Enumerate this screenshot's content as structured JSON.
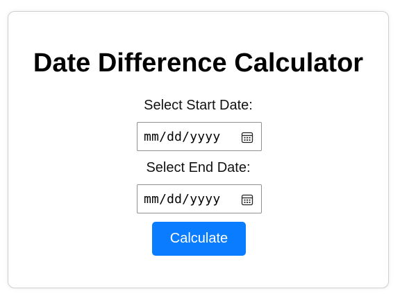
{
  "page": {
    "title": "Date Difference Calculator"
  },
  "form": {
    "start_label": "Select Start Date:",
    "start_value": "mm/dd/yyyy",
    "end_label": "Select End Date:",
    "end_value": "mm/dd/yyyy",
    "calculate_label": "Calculate"
  },
  "icons": {
    "date_picker": "calendar-icon"
  },
  "colors": {
    "button_bg": "#0a7cff",
    "button_text": "#ffffff",
    "card_border": "#cfcfcf",
    "input_border": "#8f8f8f"
  }
}
